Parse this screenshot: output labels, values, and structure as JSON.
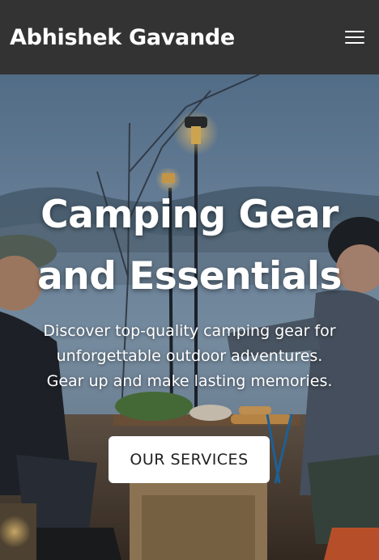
{
  "header": {
    "brand": "Abhishek Gavande",
    "menu_icon": "hamburger-menu-icon"
  },
  "hero": {
    "title_line1": "Camping Gear",
    "title_line2": "and Essentials",
    "subtitle_line1": "Discover top-quality camping gear for",
    "subtitle_line2": "unforgettable outdoor adventures.",
    "subtitle_line3": "Gear up and make lasting memories.",
    "cta_label": "OUR SERVICES"
  },
  "colors": {
    "header_bg": "#333333",
    "text": "#ffffff",
    "button_bg": "#ffffff",
    "button_text": "#222222"
  }
}
